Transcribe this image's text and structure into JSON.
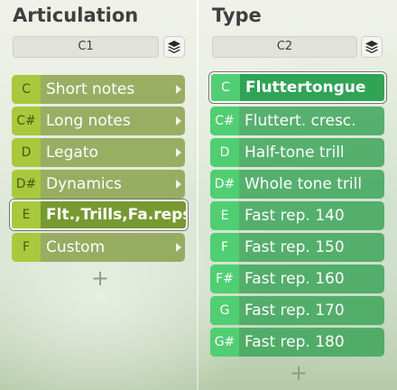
{
  "articulation": {
    "title": "Articulation",
    "key": "C1",
    "icon": "layers-icon",
    "items": [
      {
        "note": "C",
        "label": "Short notes"
      },
      {
        "note": "C#",
        "label": "Long notes"
      },
      {
        "note": "D",
        "label": "Legato"
      },
      {
        "note": "D#",
        "label": "Dynamics"
      },
      {
        "note": "E",
        "label": "Flt.,Trills,Fa.reps",
        "selected": true
      },
      {
        "note": "F",
        "label": "Custom"
      }
    ],
    "add_label": "+"
  },
  "type": {
    "title": "Type",
    "key": "C2",
    "icon": "layers-icon",
    "items": [
      {
        "note": "C",
        "label": "Fluttertongue",
        "selected": true
      },
      {
        "note": "C#",
        "label": "Fluttert. cresc."
      },
      {
        "note": "D",
        "label": "Half-tone trill"
      },
      {
        "note": "D#",
        "label": "Whole tone trill"
      },
      {
        "note": "E",
        "label": "Fast rep. 140"
      },
      {
        "note": "F",
        "label": "Fast rep. 150"
      },
      {
        "note": "F#",
        "label": "Fast rep. 160"
      },
      {
        "note": "G",
        "label": "Fast rep. 170"
      },
      {
        "note": "G#",
        "label": "Fast rep. 180"
      }
    ],
    "add_label": "+"
  },
  "colors": {
    "articulation_row": "#7a9632",
    "articulation_note": "#a9c93c",
    "type_row": "#37a455",
    "type_note": "#4fcf72"
  }
}
